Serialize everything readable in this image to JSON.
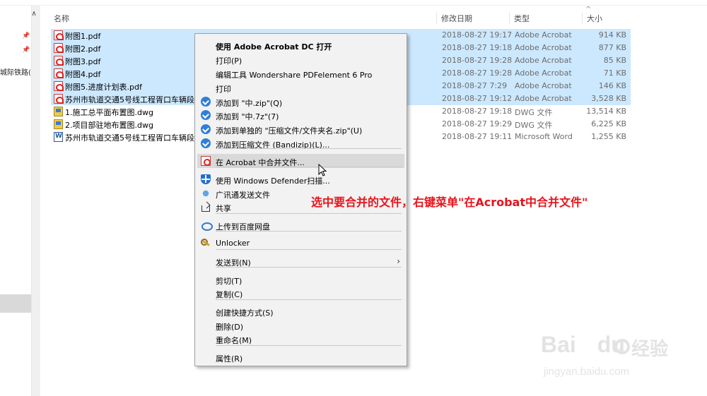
{
  "nav": {
    "item_label": "城际铁路(",
    "pin_icon": "pin-icon"
  },
  "columns": {
    "name": "名称",
    "date": "修改日期",
    "type": "类型",
    "size": "大小"
  },
  "files": [
    {
      "name": "附图1.pdf",
      "date": "2018-08-27 19:17",
      "type": "Adobe Acrobat",
      "size": "914 KB",
      "icon": "pdf-file-icon",
      "selected": true
    },
    {
      "name": "附图2.pdf",
      "date": "2018-08-27 19:18",
      "type": "Adobe Acrobat",
      "size": "877 KB",
      "icon": "pdf-file-icon",
      "selected": true
    },
    {
      "name": "附图3.pdf",
      "date": "2018-08-27 19:28",
      "type": "Adobe Acrobat",
      "size": "85 KB",
      "icon": "pdf-file-icon",
      "selected": true
    },
    {
      "name": "附图4.pdf",
      "date": "2018-08-27 19:28",
      "type": "Adobe Acrobat",
      "size": "71 KB",
      "icon": "pdf-file-icon",
      "selected": true
    },
    {
      "name": "附图5.进度计划表.pdf",
      "date": "2018-08-27 7:29",
      "type": "Adobe Acrobat",
      "size": "146 KB",
      "icon": "pdf-file-icon",
      "selected": true
    },
    {
      "name": "苏州市轨道交通5号线工程胥口车辆段及",
      "date": "2018-08-27 19:12",
      "type": "Adobe Acrobat",
      "size": "3,528 KB",
      "icon": "pdf-file-icon",
      "selected": true
    },
    {
      "name": "1.施工总平面布置图.dwg",
      "date": "2018-08-27 19:18",
      "type": "DWG 文件",
      "size": "13,514 KB",
      "icon": "dwg-file-icon",
      "selected": false
    },
    {
      "name": "2.项目部驻地布置图.dwg",
      "date": "2018-08-27 19:29",
      "type": "DWG 文件",
      "size": "6,225 KB",
      "icon": "dwg-file-icon",
      "selected": false
    },
    {
      "name": "苏州市轨道交通5号线工程胥口车辆段及",
      "date": "2018-08-27 19:11",
      "type": "Microsoft Word",
      "size": "1,255 KB",
      "icon": "word-file-icon",
      "selected": false
    }
  ],
  "context_menu": {
    "items": [
      {
        "label": "使用 Adobe Acrobat DC 打开",
        "icon": ""
      },
      {
        "label": "打印(P)",
        "icon": ""
      },
      {
        "label": "编辑工具 Wondershare PDFelement 6 Pro",
        "icon": ""
      },
      {
        "label": "打印",
        "icon": ""
      },
      {
        "label": "添加到 \"中.zip\"(Q)",
        "icon": "bandizip-icon"
      },
      {
        "label": "添加到 \"中.7z\"(7)",
        "icon": "bandizip-icon"
      },
      {
        "label": "添加到单独的 \"压缩文件/文件夹名.zip\"(U)",
        "icon": "bandizip-icon"
      },
      {
        "label": "添加到压缩文件 (Bandizip)(L)...",
        "icon": "bandizip-icon"
      },
      {
        "label": "在 Acrobat 中合并文件...",
        "icon": "acrobat-merge-icon"
      },
      {
        "label": "使用 Windows Defender扫描...",
        "icon": "windows-defender-icon"
      },
      {
        "label": "广讯通发送文件",
        "icon": "guangxuntong-icon"
      },
      {
        "label": "共享",
        "icon": "share-icon"
      },
      {
        "label": "上传到百度网盘",
        "icon": "baidu-netdisk-icon"
      },
      {
        "label": "Unlocker",
        "icon": "unlocker-icon"
      },
      {
        "label": "发送到(N)",
        "icon": ""
      },
      {
        "label": "剪切(T)",
        "icon": ""
      },
      {
        "label": "复制(C)",
        "icon": ""
      },
      {
        "label": "创建快捷方式(S)",
        "icon": ""
      },
      {
        "label": "删除(D)",
        "icon": ""
      },
      {
        "label": "重命名(M)",
        "icon": ""
      },
      {
        "label": "属性(R)",
        "icon": ""
      }
    ]
  },
  "annotation": "选中要合并的文件，右键菜单\"在Acrobat中合并文件\"",
  "watermark": {
    "brand": "Bai",
    "brand_suffix": "du",
    "cn": "经验",
    "url": "jingyan.baidu.com"
  },
  "colors": {
    "selection": "#cce8ff",
    "annotation": "#e8141c",
    "menu_bg": "#f2f2f2"
  }
}
